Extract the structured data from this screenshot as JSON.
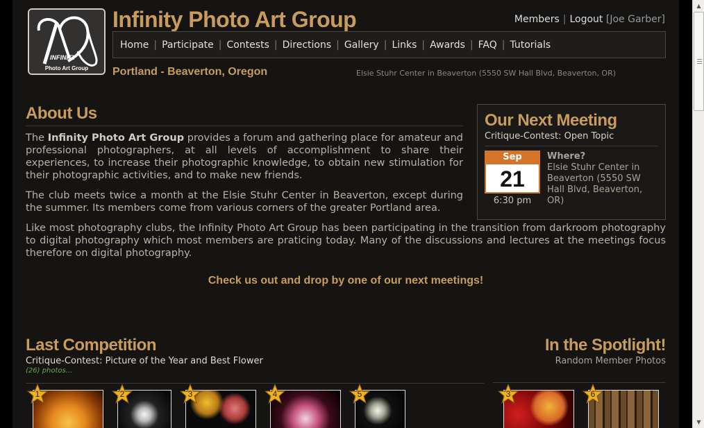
{
  "header": {
    "site_title": "Infinity Photo Art Group",
    "logo_word": "INFINITY",
    "logo_sub": "Photo Art Group",
    "location": "Portland - Beaverton, Oregon",
    "address": "Elsie Stuhr Center in Beaverton (5550 SW Hall Blvd, Beaverton, OR)"
  },
  "user": {
    "members_label": "Members",
    "logout_label": "Logout",
    "username": "[Joe Garber]"
  },
  "nav": {
    "items": [
      "Home",
      "Participate",
      "Contests",
      "Directions",
      "Gallery",
      "Links",
      "Awards",
      "FAQ",
      "Tutorials"
    ]
  },
  "about": {
    "heading": "About Us",
    "p1_a": "The ",
    "p1_b": "Infinity Photo Art Group",
    "p1_c": " provides a forum and gathering place for amateur and professional photographers, at all levels of accomplishment to share their experiences, to increase their photographic knowledge, to obtain new stimulation for their photographic activities, and to make new friends.",
    "p2": "The club meets twice a month at the Elsie Stuhr Center in Beaverton, except during the summer. Its members come from various corners of the greater Portland area.",
    "p3": "Like most photography clubs, the Infinity Photo Art Group has been participating in the transition from darkroom photography to digital photography which most members are praticing today. Many of the discussions and lectures at the meetings focus therefore on digital photography.",
    "cta": "Check us out and drop by one of our next meetings!"
  },
  "meeting": {
    "heading": "Our Next Meeting",
    "topic": "Critique-Contest: Open Topic",
    "month": "Sep",
    "day": "21",
    "time": "6:30 pm",
    "where_label": "Where?",
    "where_text": "Elsie Stuhr Center in Beaverton (5550 SW Hall Blvd, Beaverton, OR)"
  },
  "competition": {
    "heading": "Last Competition",
    "subtitle": "Critique-Contest: Picture of the Year and Best Flower",
    "count": "(26) photos...",
    "ranks": [
      "1",
      "2",
      "3",
      "4",
      "5"
    ]
  },
  "spotlight": {
    "heading": "In the Spotlight!",
    "subtitle": "Random Member Photos",
    "ranks": [
      "3",
      "6"
    ]
  },
  "colors": {
    "accent": "#c89c5b",
    "background": "#161412",
    "calendar_orange": "#d4752a",
    "star_gold": "#f2b01e"
  }
}
